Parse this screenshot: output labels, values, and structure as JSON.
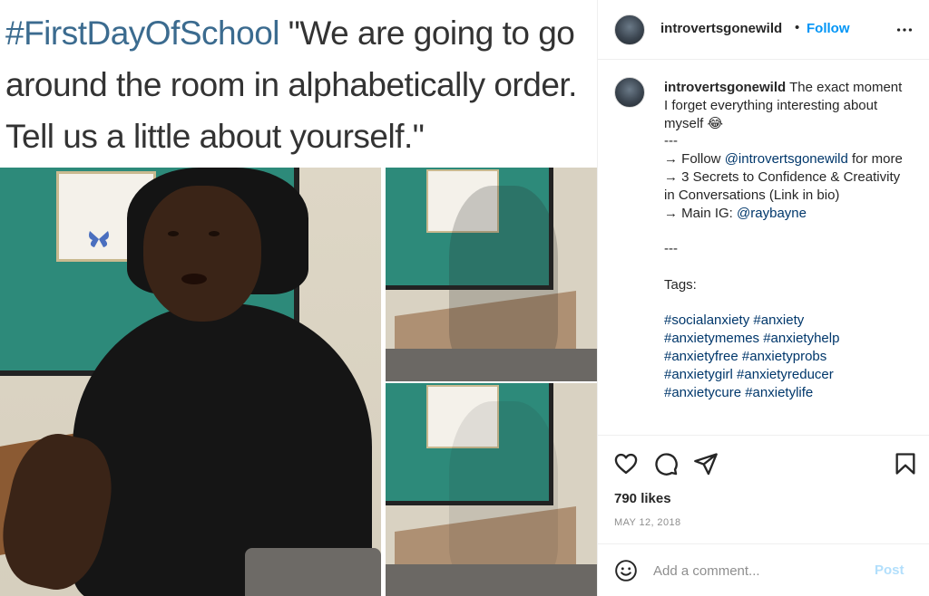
{
  "media": {
    "meme_hashtag": "#FirstDayOfSchool",
    "meme_quote": " \"We are going to go around the room in alphabetically order. Tell us a little about yourself.\""
  },
  "header": {
    "username": "introvertsgonewild",
    "separator": "•",
    "follow_label": "Follow",
    "more_icon": "more-horizontal-icon"
  },
  "caption": {
    "username": "introvertsgonewild",
    "text": "The exact moment I forget everything interesting about myself 😂",
    "separator1": "---",
    "follow_prefix": "→ Follow ",
    "follow_handle": "@introvertsgonewild",
    "follow_suffix": " for more",
    "secrets_line": "→ 3 Secrets to Confidence & Creativity in Conversations (Link in bio)",
    "main_ig_prefix": "→ Main IG: ",
    "main_ig_handle": "@raybayne",
    "separator2": "---",
    "tags_label": "Tags:",
    "hashtags_line1": "#socialanxiety #anxiety",
    "hashtags_line2": "#anxietymemes #anxietyhelp",
    "hashtags_line3": "#anxietyfree #anxietyprobs",
    "hashtags_line4": "#anxietygirl #anxietyreducer",
    "hashtags_line5": "#anxietycure #anxietylife"
  },
  "actions": {
    "icons": [
      "heart-icon",
      "comment-icon",
      "share-icon",
      "bookmark-icon"
    ],
    "likes": "790 likes",
    "date": "MAY 12, 2018"
  },
  "comment_bar": {
    "placeholder": "Add a comment...",
    "post_label": "Post"
  },
  "colors": {
    "follow_blue": "#0095f6",
    "link_blue": "#00376b",
    "post_disabled": "#b2dffc",
    "meme_hashtag": "#3b6b8f"
  }
}
